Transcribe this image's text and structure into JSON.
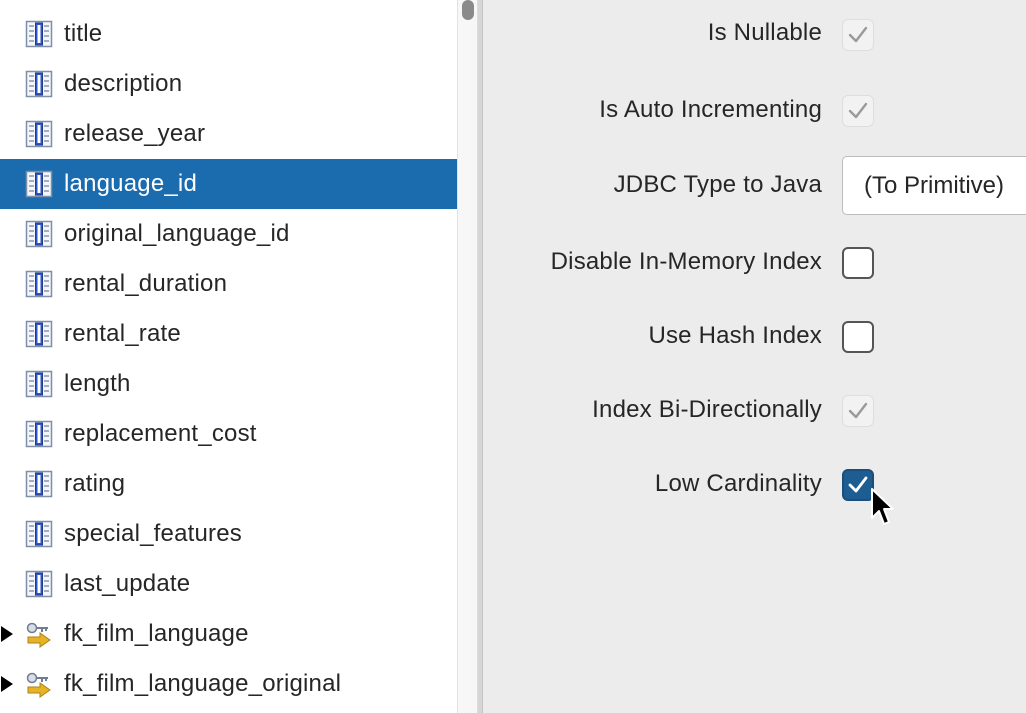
{
  "tree": {
    "items": [
      {
        "label": "title",
        "icon": "column-icon",
        "selected": false
      },
      {
        "label": "description",
        "icon": "column-icon",
        "selected": false
      },
      {
        "label": "release_year",
        "icon": "column-icon",
        "selected": false
      },
      {
        "label": "language_id",
        "icon": "column-icon",
        "selected": true
      },
      {
        "label": "original_language_id",
        "icon": "column-icon",
        "selected": false
      },
      {
        "label": "rental_duration",
        "icon": "column-icon",
        "selected": false
      },
      {
        "label": "rental_rate",
        "icon": "column-icon",
        "selected": false
      },
      {
        "label": "length",
        "icon": "column-icon",
        "selected": false
      },
      {
        "label": "replacement_cost",
        "icon": "column-icon",
        "selected": false
      },
      {
        "label": "rating",
        "icon": "column-icon",
        "selected": false
      },
      {
        "label": "special_features",
        "icon": "column-icon",
        "selected": false
      },
      {
        "label": "last_update",
        "icon": "column-icon",
        "selected": false
      },
      {
        "label": "fk_film_language",
        "icon": "foreign-key-icon",
        "selected": false,
        "collapsed": true
      },
      {
        "label": "fk_film_language_original",
        "icon": "foreign-key-icon",
        "selected": false,
        "collapsed": true
      }
    ]
  },
  "properties": {
    "is_nullable": {
      "label": "Is Nullable",
      "checked": true,
      "enabled": false
    },
    "is_auto_incrementing": {
      "label": "Is Auto Incrementing",
      "checked": true,
      "enabled": false
    },
    "jdbc_type_to_java": {
      "label": "JDBC Type to Java",
      "value": "(To Primitive)"
    },
    "disable_in_memory_index": {
      "label": "Disable In-Memory Index",
      "checked": false,
      "enabled": true
    },
    "use_hash_index": {
      "label": "Use Hash Index",
      "checked": false,
      "enabled": true
    },
    "index_bi_directionally": {
      "label": "Index Bi-Directionally",
      "checked": true,
      "enabled": false
    },
    "low_cardinality": {
      "label": "Low Cardinality",
      "checked": true,
      "enabled": true
    }
  },
  "colors": {
    "selection": "#1b6cae",
    "checkbox_checked": "#1d5d92",
    "panel_background": "#ececec"
  }
}
